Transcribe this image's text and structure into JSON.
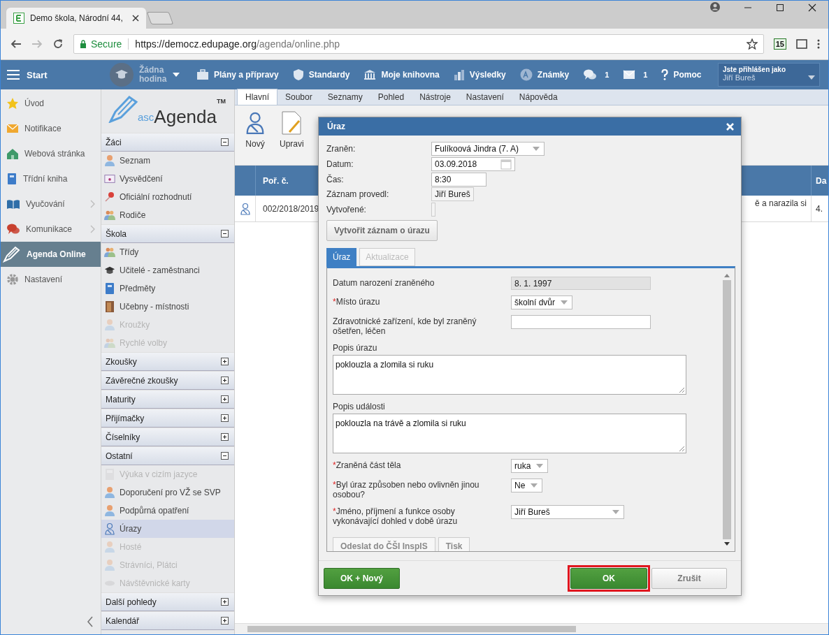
{
  "browser": {
    "tab_title": "Demo škola, Národní 44,",
    "secure_label": "Secure",
    "url": {
      "host": "https://democz.edupage.org",
      "path": "/agenda/online.php"
    },
    "extension_badge": "15"
  },
  "topbar": {
    "start": "Start",
    "lesson": "Žádna hodina",
    "items": [
      {
        "label": "Plány a přípravy"
      },
      {
        "label": "Standardy"
      },
      {
        "label": "Moje knihovna"
      },
      {
        "label": "Výsledky"
      },
      {
        "label": "Známky"
      },
      {
        "count": "1"
      },
      {
        "count": "1"
      },
      {
        "label": "Pomoc"
      }
    ],
    "user": {
      "caption": "Jste přihlášen jako",
      "name": "Jiří Bureš"
    }
  },
  "sidebar": {
    "items": [
      {
        "label": "Úvod",
        "selected": false,
        "submenu": false
      },
      {
        "label": "Notifikace",
        "selected": false,
        "submenu": false
      },
      {
        "label": "Webová stránka",
        "selected": false,
        "submenu": false
      },
      {
        "label": "Třídní kniha",
        "selected": false,
        "submenu": false
      },
      {
        "label": "Vyučování",
        "selected": false,
        "submenu": true
      },
      {
        "label": "Komunikace",
        "selected": false,
        "submenu": true
      },
      {
        "label": "Agenda Online",
        "selected": true,
        "submenu": false
      },
      {
        "label": "Nastavení",
        "selected": false,
        "submenu": false
      }
    ]
  },
  "agenda_logo": {
    "prefix": "asc",
    "name": "Agenda",
    "mark": "TM"
  },
  "sections": [
    {
      "title": "Žáci",
      "expanded": true,
      "items": [
        {
          "label": "Seznam",
          "disabled": false,
          "selected": false
        },
        {
          "label": "Vysvědčení",
          "disabled": false,
          "selected": false
        },
        {
          "label": "Oficiální rozhodnutí",
          "disabled": false,
          "selected": false
        },
        {
          "label": "Rodiče",
          "disabled": false,
          "selected": false
        }
      ]
    },
    {
      "title": "Škola",
      "expanded": true,
      "items": [
        {
          "label": "Třídy",
          "disabled": false,
          "selected": false
        },
        {
          "label": "Učitelé - zaměstnanci",
          "disabled": false,
          "selected": false
        },
        {
          "label": "Předměty",
          "disabled": false,
          "selected": false
        },
        {
          "label": "Učebny - místnosti",
          "disabled": false,
          "selected": false
        },
        {
          "label": "Kroužky",
          "disabled": true,
          "selected": false
        },
        {
          "label": "Rychlé volby",
          "disabled": true,
          "selected": false
        }
      ]
    },
    {
      "title": "Zkoušky",
      "expanded": false
    },
    {
      "title": "Závěrečné zkoušky",
      "expanded": false
    },
    {
      "title": "Maturity",
      "expanded": false
    },
    {
      "title": "Přijímačky",
      "expanded": false
    },
    {
      "title": "Číselníky",
      "expanded": false
    },
    {
      "title": "Ostatní",
      "expanded": true,
      "items": [
        {
          "label": "Výuka v cizím jazyce",
          "disabled": true,
          "selected": false
        },
        {
          "label": "Doporučení pro VŽ se SVP",
          "disabled": false,
          "selected": false
        },
        {
          "label": "Podpůrná opatření",
          "disabled": false,
          "selected": false
        },
        {
          "label": "Úrazy",
          "disabled": false,
          "selected": true
        },
        {
          "label": "Hosté",
          "disabled": true,
          "selected": false
        },
        {
          "label": "Strávníci, Plátci",
          "disabled": true,
          "selected": false
        },
        {
          "label": "Návštěvnické karty",
          "disabled": true,
          "selected": false
        }
      ]
    },
    {
      "title": "Další pohledy",
      "expanded": false
    },
    {
      "title": "Kalendář",
      "expanded": false
    }
  ],
  "ribbon": {
    "tabs": [
      {
        "label": "Hlavní",
        "selected": true
      },
      {
        "label": "Soubor",
        "selected": false
      },
      {
        "label": "Seznamy",
        "selected": false
      },
      {
        "label": "Pohled",
        "selected": false
      },
      {
        "label": "Nástroje",
        "selected": false
      },
      {
        "label": "Nastavení",
        "selected": false
      },
      {
        "label": "Nápověda",
        "selected": false
      }
    ],
    "tools": [
      {
        "label": "Nový"
      },
      {
        "label": "Upravi"
      }
    ]
  },
  "table": {
    "columns": [
      "Poř. č.",
      "",
      "Da"
    ],
    "rows": [
      {
        "cells": [
          "002/2018/2019",
          "ě a narazila si",
          "4."
        ]
      }
    ]
  },
  "dialog": {
    "title": "Úraz",
    "fields": [
      {
        "label": "Zraněn:",
        "kind": "select",
        "value": "Fulíkoová Jindra (7. A)"
      },
      {
        "label": "Datum:",
        "kind": "date",
        "value": "03.09.2018"
      },
      {
        "label": "Čas:",
        "kind": "text",
        "value": "8:30"
      },
      {
        "label": "Záznam provedl:",
        "kind": "static",
        "value": "Jiří Bureš"
      },
      {
        "label": "Vytvořené:",
        "kind": "static"
      }
    ],
    "create_button": "Vytvořit záznam o úrazu",
    "tabs": [
      {
        "label": "Úraz",
        "selected": true,
        "disabled": false
      },
      {
        "label": "Aktualizace",
        "selected": false,
        "disabled": true
      }
    ],
    "rows": [
      {
        "label": "Datum narození zraněného",
        "kind": "readonly",
        "value": "8. 1. 1997"
      },
      {
        "mark": "*",
        "label": "Místo úrazu",
        "kind": "select",
        "value": "školní dvůr"
      },
      {
        "label": "Zdravotnické zařízení, kde byl zraněný ošetřen, léčen",
        "kind": "text"
      },
      {
        "label": "Popis úrazu",
        "kind": "textarea",
        "value": "poklouzla a zlomila si  ruku"
      },
      {
        "label": "Popis události",
        "kind": "textarea",
        "value": "poklouzla na trávě a zlomila si  ruku"
      },
      {
        "mark": "*",
        "label": "Zraněná část těla",
        "kind": "select",
        "value": "ruka"
      },
      {
        "mark": "*",
        "label": "Byl úraz způsoben nebo ovlivněn jinou osobou?",
        "kind": "select",
        "value": "Ne"
      },
      {
        "mark": "*",
        "label": "Jméno, příjmení a funkce osoby vykonávající dohled v době úrazu",
        "kind": "wideselect",
        "value": "Jiří Bureš"
      }
    ],
    "panel_buttons": [
      "Odeslat do ČŠI InspIS",
      "Tisk"
    ],
    "footer": [
      {
        "label": "OK + Nový",
        "kind": "green",
        "highlighted": false
      },
      {
        "label": "OK",
        "kind": "green",
        "highlighted": true
      },
      {
        "label": "Zrušit",
        "kind": "plain",
        "highlighted": false
      }
    ]
  }
}
